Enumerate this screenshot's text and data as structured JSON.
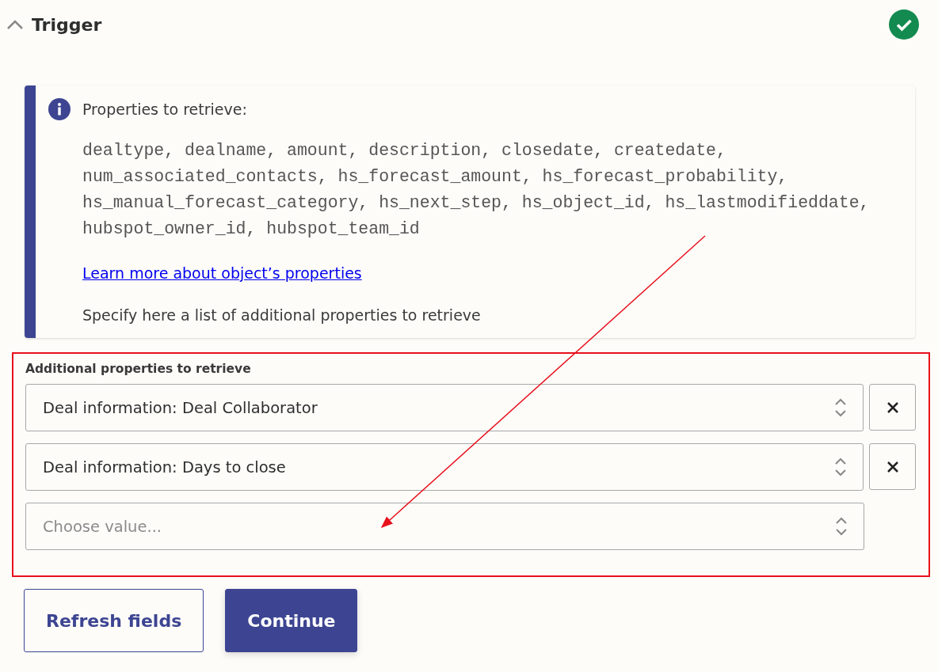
{
  "section": {
    "title": "Trigger",
    "expanded": true,
    "completed": true
  },
  "info": {
    "title": "Properties to retrieve:",
    "properties": [
      "dealtype, dealname, amount, description, closedate, createdate,",
      "num_associated_contacts, hs_forecast_amount, hs_forecast_probability,",
      "hs_manual_forecast_category, hs_next_step, hs_object_id, hs_lastmodifieddate,",
      "hubspot_owner_id, hubspot_team_id"
    ],
    "link": "Learn more about object’s properties",
    "note": "Specify here a list of additional properties to retrieve"
  },
  "field": {
    "label": "Additional properties to retrieve",
    "highlighted": true,
    "values": [
      {
        "value": "Deal information: Deal Collaborator"
      },
      {
        "value": "Deal information: Days to close"
      }
    ],
    "placeholder": "Choose value..."
  },
  "buttons": [
    {
      "label": "Refresh fields",
      "kind": "secondary"
    },
    {
      "label": "Continue",
      "kind": "primary"
    }
  ]
}
